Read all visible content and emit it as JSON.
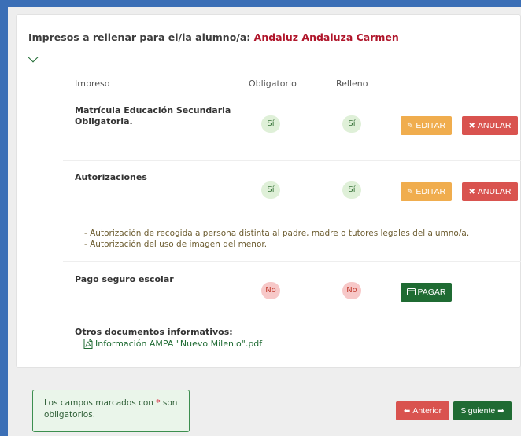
{
  "panel": {
    "title_prefix": "Impresos a rellenar para el/la alumno/a:",
    "student_name": "Andaluz Andaluza Carmen"
  },
  "table": {
    "headers": {
      "document": "Impreso",
      "mandatory": "Obligatorio",
      "filled": "Relleno"
    },
    "rows": [
      {
        "title_line1": "Matrícula Educación Secundaria",
        "title_line2": "Obligatoria.",
        "mandatory": "Sí",
        "filled": "Sí",
        "edit_label": "EDITAR",
        "cancel_label": "ANULAR"
      },
      {
        "title_line1": "Autorizaciones",
        "mandatory": "Sí",
        "filled": "Sí",
        "edit_label": "EDITAR",
        "cancel_label": "ANULAR",
        "notes": [
          "- Autorización de recogida a persona distinta al padre, madre o tutores legales del alumno/a.",
          "- Autorización del uso de imagen del menor."
        ]
      },
      {
        "title_line1": "Pago seguro escolar",
        "mandatory": "No",
        "filled": "No",
        "pay_label": "PAGAR"
      }
    ]
  },
  "other_docs": {
    "heading": "Otros documentos informativos:",
    "link_label": "Información AMPA \"Nuevo Milenio\".pdf",
    "icon": "pdf-file-icon"
  },
  "footer": {
    "notice_before": "Los campos marcados con ",
    "notice_star": "*",
    "notice_after": " son obligatorios.",
    "prev_label": "Anterior",
    "next_label": "Siguiente"
  },
  "colors": {
    "brand_green": "#1f6b33",
    "danger": "#d9534f",
    "warning": "#f0ad4e",
    "student_name": "#b0162b"
  }
}
